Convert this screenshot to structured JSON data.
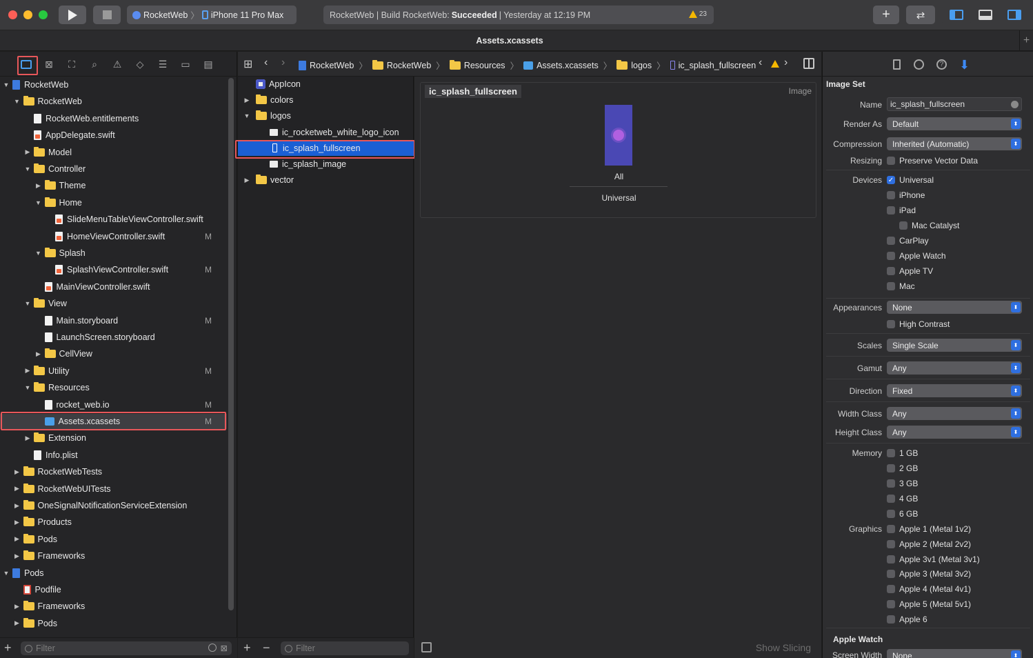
{
  "toolbar": {
    "scheme_project": "RocketWeb",
    "scheme_device": "iPhone 11 Pro Max",
    "status_prefix": "RocketWeb | Build RocketWeb:",
    "status_result": "Succeeded",
    "status_time": "| Yesterday at 12:19 PM",
    "warning_count": "23"
  },
  "tab": {
    "title": "Assets.xcassets"
  },
  "navigator": {
    "rows": [
      {
        "label": "RocketWeb",
        "indent": 0,
        "kind": "proj",
        "disc": "open",
        "mark": ""
      },
      {
        "label": "RocketWeb",
        "indent": 1,
        "kind": "folder",
        "disc": "open",
        "mark": ""
      },
      {
        "label": "RocketWeb.entitlements",
        "indent": 2,
        "kind": "file",
        "disc": "",
        "mark": ""
      },
      {
        "label": "AppDelegate.swift",
        "indent": 2,
        "kind": "swift",
        "disc": "",
        "mark": ""
      },
      {
        "label": "Model",
        "indent": 2,
        "kind": "folder",
        "disc": "closed",
        "mark": ""
      },
      {
        "label": "Controller",
        "indent": 2,
        "kind": "folder",
        "disc": "open",
        "mark": ""
      },
      {
        "label": "Theme",
        "indent": 3,
        "kind": "folder",
        "disc": "closed",
        "mark": ""
      },
      {
        "label": "Home",
        "indent": 3,
        "kind": "folder",
        "disc": "open",
        "mark": ""
      },
      {
        "label": "SlideMenuTableViewController.swift",
        "indent": 4,
        "kind": "swift",
        "disc": "",
        "mark": ""
      },
      {
        "label": "HomeViewController.swift",
        "indent": 4,
        "kind": "swift",
        "disc": "",
        "mark": "M"
      },
      {
        "label": "Splash",
        "indent": 3,
        "kind": "folder",
        "disc": "open",
        "mark": ""
      },
      {
        "label": "SplashViewController.swift",
        "indent": 4,
        "kind": "swift",
        "disc": "",
        "mark": "M"
      },
      {
        "label": "MainViewController.swift",
        "indent": 3,
        "kind": "swift",
        "disc": "",
        "mark": ""
      },
      {
        "label": "View",
        "indent": 2,
        "kind": "folder",
        "disc": "open",
        "mark": ""
      },
      {
        "label": "Main.storyboard",
        "indent": 3,
        "kind": "file",
        "disc": "",
        "mark": "M"
      },
      {
        "label": "LaunchScreen.storyboard",
        "indent": 3,
        "kind": "file",
        "disc": "",
        "mark": ""
      },
      {
        "label": "CellView",
        "indent": 3,
        "kind": "folder",
        "disc": "closed",
        "mark": ""
      },
      {
        "label": "Utility",
        "indent": 2,
        "kind": "folder",
        "disc": "closed",
        "mark": "M"
      },
      {
        "label": "Resources",
        "indent": 2,
        "kind": "folder",
        "disc": "open",
        "mark": ""
      },
      {
        "label": "rocket_web.io",
        "indent": 3,
        "kind": "file",
        "disc": "",
        "mark": "M"
      },
      {
        "label": "Assets.xcassets",
        "indent": 3,
        "kind": "xc",
        "disc": "",
        "mark": "M",
        "selected": true
      },
      {
        "label": "Extension",
        "indent": 2,
        "kind": "folder",
        "disc": "closed",
        "mark": ""
      },
      {
        "label": "Info.plist",
        "indent": 2,
        "kind": "file",
        "disc": "",
        "mark": ""
      },
      {
        "label": "RocketWebTests",
        "indent": 1,
        "kind": "folder",
        "disc": "closed",
        "mark": ""
      },
      {
        "label": "RocketWebUITests",
        "indent": 1,
        "kind": "folder",
        "disc": "closed",
        "mark": ""
      },
      {
        "label": "OneSignalNotificationServiceExtension",
        "indent": 1,
        "kind": "folder",
        "disc": "closed",
        "mark": ""
      },
      {
        "label": "Products",
        "indent": 1,
        "kind": "folder",
        "disc": "closed",
        "mark": ""
      },
      {
        "label": "Pods",
        "indent": 1,
        "kind": "folder",
        "disc": "closed",
        "mark": ""
      },
      {
        "label": "Frameworks",
        "indent": 1,
        "kind": "folder",
        "disc": "closed",
        "mark": ""
      },
      {
        "label": "Pods",
        "indent": 0,
        "kind": "proj",
        "disc": "open",
        "mark": ""
      },
      {
        "label": "Podfile",
        "indent": 1,
        "kind": "pod",
        "disc": "",
        "mark": ""
      },
      {
        "label": "Frameworks",
        "indent": 1,
        "kind": "folder",
        "disc": "closed",
        "mark": ""
      },
      {
        "label": "Pods",
        "indent": 1,
        "kind": "folder",
        "disc": "closed",
        "mark": ""
      }
    ],
    "filter_placeholder": "Filter"
  },
  "jumpbar": {
    "crumbs": [
      "RocketWeb",
      "RocketWeb",
      "Resources",
      "Assets.xcassets",
      "logos",
      "ic_splash_fullscreen"
    ]
  },
  "assets": {
    "rows": [
      {
        "label": "AppIcon",
        "indent": 0,
        "kind": "appicon",
        "disc": ""
      },
      {
        "label": "colors",
        "indent": 0,
        "kind": "folder",
        "disc": "closed"
      },
      {
        "label": "logos",
        "indent": 0,
        "kind": "folder",
        "disc": "open"
      },
      {
        "label": "ic_rocketweb_white_logo_icon",
        "indent": 1,
        "kind": "img",
        "disc": ""
      },
      {
        "label": "ic_splash_fullscreen",
        "indent": 1,
        "kind": "imgset",
        "disc": "",
        "selected": true
      },
      {
        "label": "ic_splash_image",
        "indent": 1,
        "kind": "img",
        "disc": ""
      },
      {
        "label": "vector",
        "indent": 0,
        "kind": "folder",
        "disc": "closed"
      }
    ],
    "filter_placeholder": "Filter"
  },
  "canvas": {
    "set_name": "ic_splash_fullscreen",
    "kind_label": "Image",
    "slot_label": "All",
    "slot_group": "Universal",
    "show_slicing": "Show Slicing"
  },
  "inspector": {
    "section_title": "Image Set",
    "name_label": "Name",
    "name_value": "ic_splash_fullscreen",
    "render_as_label": "Render As",
    "render_as_value": "Default",
    "compression_label": "Compression",
    "compression_value": "Inherited (Automatic)",
    "resizing_label": "Resizing",
    "resizing_option": "Preserve Vector Data",
    "devices_label": "Devices",
    "devices": [
      {
        "label": "Universal",
        "checked": true,
        "indent": 0
      },
      {
        "label": "iPhone",
        "checked": false,
        "indent": 0
      },
      {
        "label": "iPad",
        "checked": false,
        "indent": 0
      },
      {
        "label": "Mac Catalyst",
        "checked": false,
        "indent": 1
      },
      {
        "label": "CarPlay",
        "checked": false,
        "indent": 0
      },
      {
        "label": "Apple Watch",
        "checked": false,
        "indent": 0
      },
      {
        "label": "Apple TV",
        "checked": false,
        "indent": 0
      },
      {
        "label": "Mac",
        "checked": false,
        "indent": 0
      }
    ],
    "appearances_label": "Appearances",
    "appearances_value": "None",
    "high_contrast": "High Contrast",
    "scales_label": "Scales",
    "scales_value": "Single Scale",
    "gamut_label": "Gamut",
    "gamut_value": "Any",
    "direction_label": "Direction",
    "direction_value": "Fixed",
    "width_class_label": "Width Class",
    "width_class_value": "Any",
    "height_class_label": "Height Class",
    "height_class_value": "Any",
    "memory_label": "Memory",
    "memory": [
      "1 GB",
      "2 GB",
      "3 GB",
      "4 GB",
      "6 GB"
    ],
    "graphics_label": "Graphics",
    "graphics": [
      "Apple 1 (Metal 1v2)",
      "Apple 2 (Metal 2v2)",
      "Apple 3v1 (Metal 3v1)",
      "Apple 3 (Metal 3v2)",
      "Apple 4 (Metal 4v1)",
      "Apple 5 (Metal 5v1)",
      "Apple 6"
    ],
    "watch_section": "Apple Watch",
    "screen_width_label": "Screen Width",
    "screen_width_value": "None"
  }
}
